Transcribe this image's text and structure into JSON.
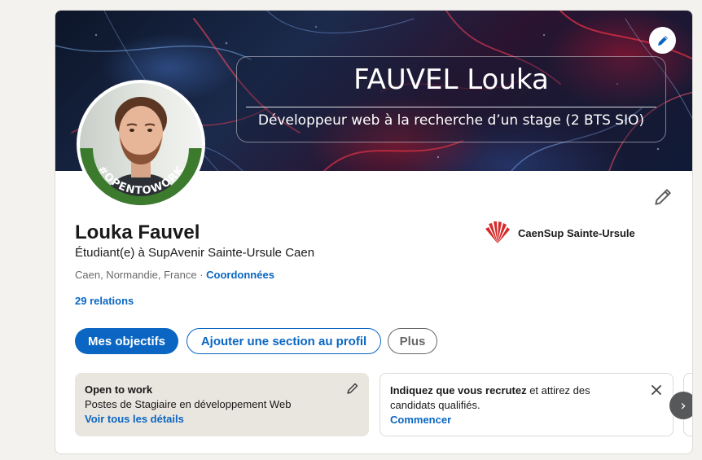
{
  "banner": {
    "title": "FAUVEL Louka",
    "subtitle": "Développeur web à la recherche d’un stage (2 BTS SIO)"
  },
  "avatar": {
    "badge_text": "#OPENTOWORK",
    "badge_color": "#3c7a2e"
  },
  "profile": {
    "name": "Louka Fauvel",
    "headline": "Étudiant(e) à SupAvenir Sainte-Ursule Caen",
    "location": "Caen, Normandie, France",
    "separator": " · ",
    "contact_link": "Coordonnées",
    "relations": "29 relations"
  },
  "school": {
    "name": "CaenSup Sainte-Ursule",
    "logo_color": "#d62b2b"
  },
  "actions": {
    "primary": "Mes objectifs",
    "add_section": "Ajouter une section au profil",
    "more": "Plus"
  },
  "open_to_work": {
    "title": "Open to work",
    "description": "Postes de Stagiaire en développement Web",
    "link": "Voir tous les détails"
  },
  "hiring": {
    "text_strong": "Indiquez que vous recrutez",
    "text_rest": " et attirez des candidats qualifiés.",
    "link": "Commencer"
  },
  "carousel": {
    "next_icon": "›"
  },
  "colors": {
    "accent": "#0a66c2",
    "page_bg": "#f4f2ee"
  },
  "icons": [
    "pencil-icon",
    "close-icon",
    "chevron-right-icon",
    "school-logo-icon"
  ]
}
